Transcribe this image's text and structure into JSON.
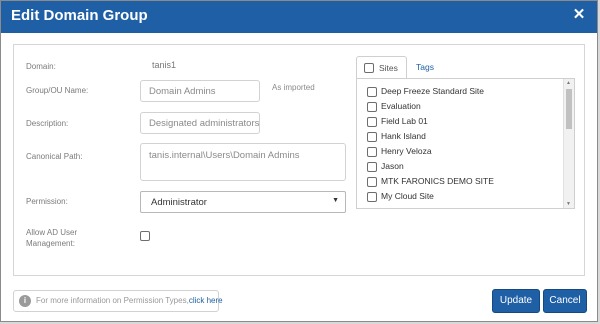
{
  "dialog": {
    "title": "Edit Domain Group",
    "close_symbol": "✕"
  },
  "form": {
    "domain_label": "Domain:",
    "domain_value": "tanis1",
    "group_label": "Group/OU Name:",
    "group_value": "Domain Admins",
    "group_note": "As imported",
    "description_label": "Description:",
    "description_value": "Designated administrators",
    "canonical_label": "Canonical Path:",
    "canonical_value": "tanis.internal\\Users\\Domain Admins",
    "permission_label": "Permission:",
    "permission_value": "Administrator",
    "allow_label_line1": "Allow AD User",
    "allow_label_line2": "Management:",
    "allow_checked": false
  },
  "tabs": {
    "sites_label": "Sites",
    "tags_label": "Tags"
  },
  "sites": [
    "Deep Freeze Standard Site",
    "Evaluation",
    "Field Lab 01",
    "Hank Island",
    "Henry Veloza",
    "Jason",
    "MTK FARONICS DEMO SITE",
    "My Cloud Site"
  ],
  "footer": {
    "info_text": "For more information on Permission Types,",
    "info_link": "click here",
    "update_label": "Update",
    "cancel_label": "Cancel"
  },
  "colors": {
    "accent": "#1e5fa6"
  },
  "icons": {
    "close": "close-icon",
    "info": "info-icon",
    "dropdown": "chevron-down-icon"
  }
}
